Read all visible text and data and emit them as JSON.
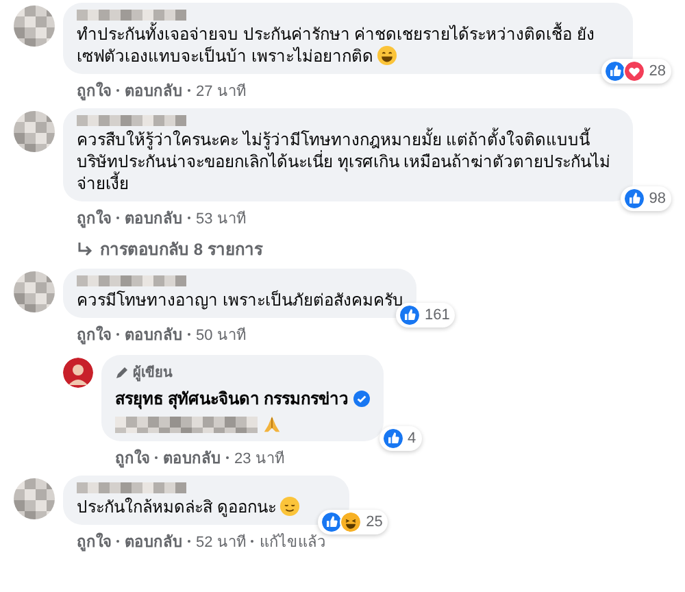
{
  "comments": [
    {
      "text": "ทำประกันทั้งเจอจ่ายจบ ประกันค่ารักษา ค่าชดเชยรายได้ระหว่างติดเชื้อ ยัง เซฟตัวเองแทบจะเป็นบ้า เพราะไม่อยากติด",
      "emoji": {
        "kind": "laugh"
      },
      "reactions": [
        {
          "kind": "like"
        },
        {
          "kind": "love"
        }
      ],
      "reaction_count": "28",
      "actions": [
        "ถูกใจ",
        "ตอบกลับ",
        "27 นาที"
      ]
    },
    {
      "text": "ควรสืบให้รู้ว่าใครนะคะ ไม่รู้ว่ามีโทษทางกฎหมายมั้ย แต่ถ้าตั้งใจติดแบบนี้ บริษัทประกันน่าจะขอยกเลิกได้นะเนี่ย ทุเรศเกิน เหมือนถ้าฆ่าตัวตายประกันไม่จ่ายเงี้ย",
      "reactions": [
        {
          "kind": "like"
        }
      ],
      "reaction_count": "98",
      "actions": [
        "ถูกใจ",
        "ตอบกลับ",
        "53 นาที"
      ],
      "replies_link": "การตอบกลับ 8 รายการ"
    },
    {
      "text": "ควรมีโทษทางอาญา เพราะเป็นภัยต่อสังคมครับ",
      "reactions": [
        {
          "kind": "like"
        }
      ],
      "reaction_count": "161",
      "actions": [
        "ถูกใจ",
        "ตอบกลับ",
        "50 นาที"
      ],
      "children": [
        {
          "badge": "ผู้เขียน",
          "author": "สรยุทธ สุทัศนะจินดา กรรมกรข่าว",
          "verified": true,
          "emoji": {
            "kind": "pray"
          },
          "reactions": [
            {
              "kind": "like"
            }
          ],
          "reaction_count": "4",
          "actions": [
            "ถูกใจ",
            "ตอบกลับ",
            "23 นาที"
          ]
        }
      ]
    },
    {
      "text": "ประกันใกล้หมดล่ะสิ ดูออกนะ",
      "emoji": {
        "kind": "relieved"
      },
      "reactions": [
        {
          "kind": "like"
        },
        {
          "kind": "haha"
        }
      ],
      "reaction_count": "25",
      "actions": [
        "ถูกใจ",
        "ตอบกลับ",
        "52 นาที",
        "แก้ไขแล้ว"
      ]
    }
  ]
}
